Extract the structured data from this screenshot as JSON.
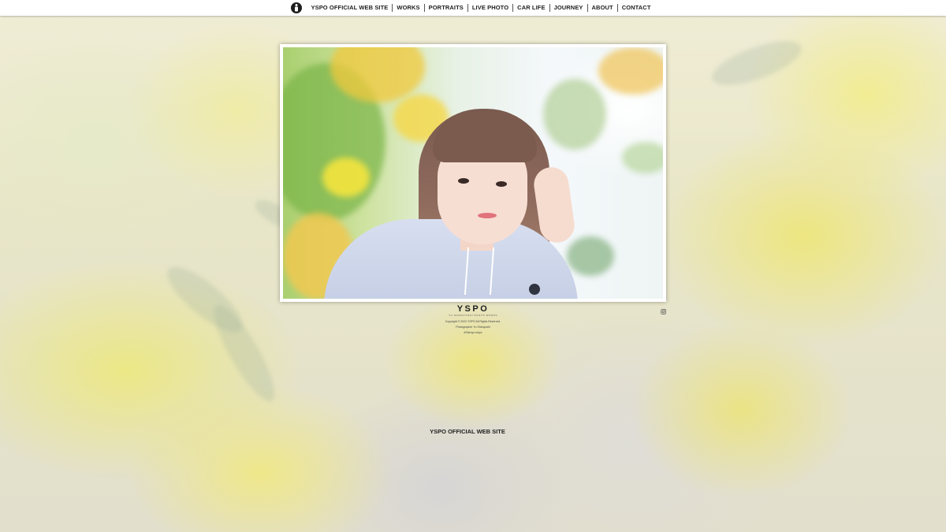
{
  "nav": {
    "logo_icon": "camera-lens-logo-icon",
    "items": [
      {
        "label": "YSPO OFFICIAL WEB SITE"
      },
      {
        "label": "WORKS"
      },
      {
        "label": "PORTRAITS"
      },
      {
        "label": "LIVE PHOTO"
      },
      {
        "label": "CAR LIFE"
      },
      {
        "label": "JOURNEY"
      },
      {
        "label": "ABOUT"
      },
      {
        "label": "CONTACT"
      }
    ]
  },
  "hero": {
    "image_subject": "portrait of a woman among yellow mimosa flowers"
  },
  "footer": {
    "brand": "YSPO",
    "brand_sub": "YU SHIRAYOSHI PHOTO WORKS",
    "copyright_lines": [
      "Copyright © 2022 YSPO All Rights Reserved.",
      "Photographer Yu Shirayoshi"
    ],
    "tag": "#Shiroyo tokyo",
    "instagram_icon": "instagram-icon"
  },
  "page_caption": "YSPO OFFICIAL WEB SITE",
  "colors": {
    "nav_background": "#ffffff",
    "nav_text": "#222222",
    "mimosa_yellow": "#eee678",
    "frame": "#ffffff"
  }
}
